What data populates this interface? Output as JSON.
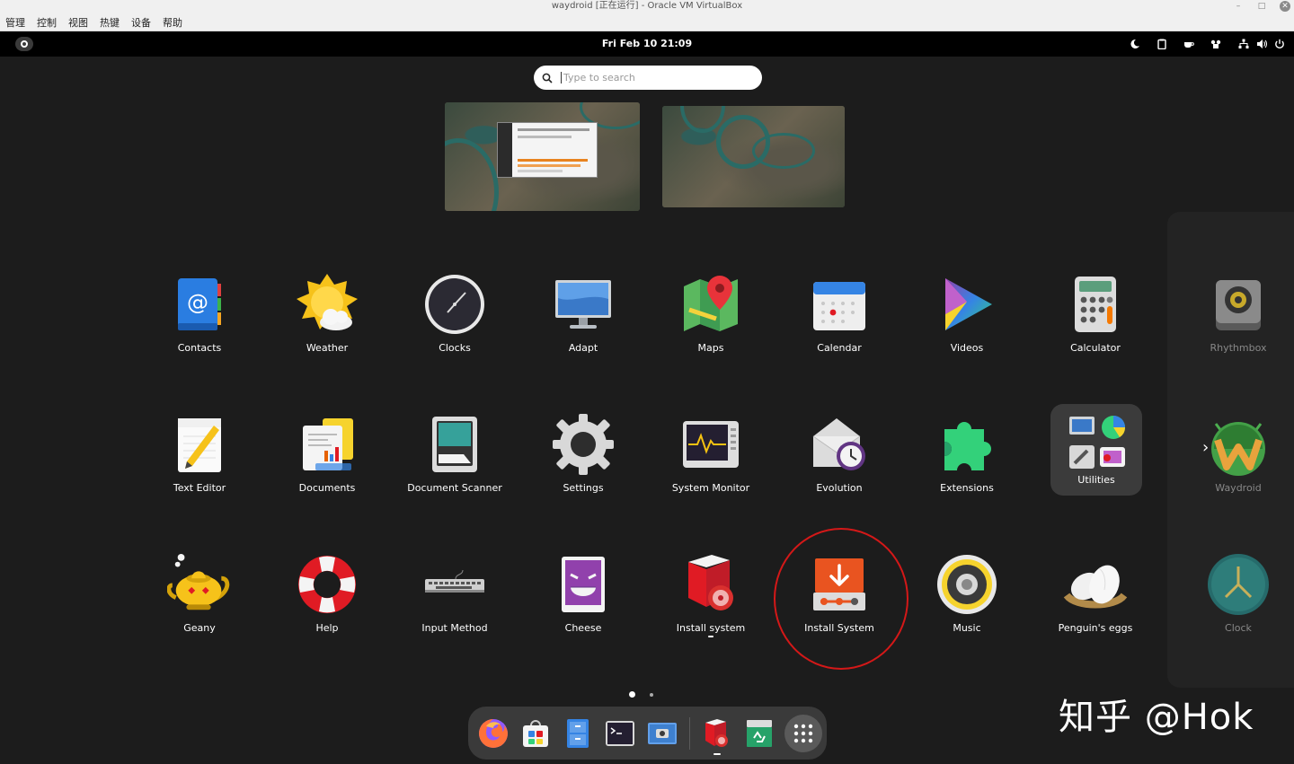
{
  "window": {
    "title": "waydroid [正在运行] - Oracle VM VirtualBox",
    "controls": {
      "minimize": "–",
      "maximize": "□",
      "close": "✕"
    }
  },
  "vbox_menu": [
    "管理",
    "控制",
    "视图",
    "热键",
    "设备",
    "帮助"
  ],
  "topbar": {
    "datetime": "Fri Feb 10  21:09"
  },
  "search": {
    "placeholder": "Type to search"
  },
  "apps": {
    "row1": [
      "Contacts",
      "Weather",
      "Clocks",
      "Adapt",
      "Maps",
      "Calendar",
      "Videos",
      "Calculator"
    ],
    "row2": [
      "Text Editor",
      "Documents",
      "Document Scanner",
      "Settings",
      "System Monitor",
      "Evolution",
      "Extensions",
      "Utilities"
    ],
    "row3": [
      "Geany",
      "Help",
      "Input Method",
      "Cheese",
      "Install system",
      "Install System",
      "Music",
      "Penguin's eggs"
    ],
    "next_page": [
      "Rhythmbox",
      "Waydroid",
      "Clock"
    ]
  },
  "watermark": "知乎 @Hok",
  "colors": {
    "accent_circle": "#d41818",
    "dash_bg": "#3a3a3a",
    "folder_bg": "#3b3b3b"
  }
}
